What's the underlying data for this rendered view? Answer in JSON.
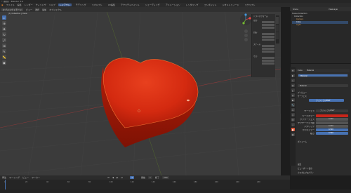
{
  "app": {
    "title": "* (無題) - Blender 3.6"
  },
  "menu": {
    "items": [
      "ファイル",
      "編集",
      "レンダー",
      "ウィンドウ",
      "ヘルプ"
    ],
    "workspaces": [
      "レイアウト",
      "モデリング",
      "スカルプト",
      "UV編集",
      "テクスチャペイント",
      "シェーディング",
      "アニメーション",
      "レンダリング",
      "コンポジット",
      "ジオメトリノード",
      "スクリプト"
    ],
    "active_workspace": "レイアウト"
  },
  "viewport": {
    "header_items": [
      "オブジェクトモード",
      "ビュー",
      "選択",
      "追加",
      "オブジェクト"
    ],
    "overlay_text_1": "ユーザー・透視投影",
    "overlay_text_2": "(1) Collection | Cube",
    "background": "#3b3b3b",
    "object_color": "#d42a10"
  },
  "toolbar": {
    "tools": [
      "cursor",
      "move",
      "rotate",
      "scale",
      "transform",
      "annotate",
      "measure",
      "add-cube"
    ]
  },
  "npanel": {
    "title": "トランスフォーム",
    "rows": [
      "位置:",
      "X",
      "Y",
      "Z",
      "回転:",
      "X",
      "Y",
      "Z",
      "スケール:",
      "X",
      "Y",
      "Z",
      "寸法:",
      "X",
      "Y",
      "Z"
    ],
    "tabs": [
      "アイテム",
      "ツール",
      "ビュー"
    ]
  },
  "outliner": {
    "items": [
      "Scene Collection",
      "Collection",
      "Camera",
      "Cube",
      "Light"
    ],
    "scene_label": "Scene",
    "layer_label": "ViewLayer"
  },
  "properties": {
    "header": [
      "Cube",
      "Material"
    ],
    "slot": "Material",
    "sections": [
      "プレビュー",
      "サーフェス"
    ],
    "surface_label": "プリンシプルBSDF",
    "rows": [
      {
        "label": "サーフェス",
        "value": "プリンシプルBSDF"
      },
      {
        "label": "ベースカラー",
        "value": ""
      },
      {
        "label": "サブサーフェス",
        "value": "0.000"
      },
      {
        "label": "サブサーフェス範囲",
        "value": ""
      },
      {
        "label": "メタリック",
        "value": "0.000"
      },
      {
        "label": "スペキュラー",
        "value": "0.500"
      },
      {
        "label": "粗さ",
        "value": "0.500"
      }
    ],
    "subsections": [
      "ボリューム",
      "設定",
      "ビューポート表示",
      "カスタムプロパティ"
    ],
    "settings_rows": [
      "ビューポート表示",
      "カスタムプロパティ"
    ],
    "base_color": "#c8251a",
    "accent": "#4772b3"
  },
  "timeline": {
    "menu": [
      "再生",
      "キーイング",
      "ビュー",
      "マーカー"
    ],
    "ticks": [
      "0",
      "20",
      "40",
      "60",
      "80",
      "100",
      "120",
      "140",
      "160",
      "180",
      "200",
      "220",
      "240"
    ],
    "current_frame": "1",
    "start_label": "開始",
    "start": "1",
    "end_label": "終了",
    "end": "250"
  }
}
